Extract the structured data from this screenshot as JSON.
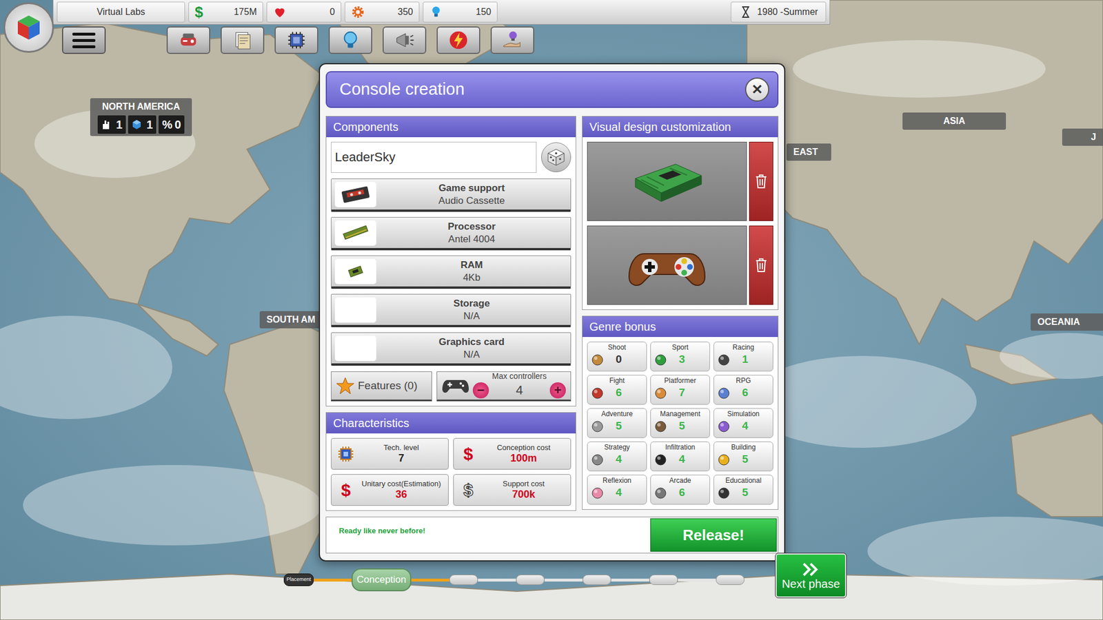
{
  "top_bar": {
    "company": "Virtual Labs",
    "stats": [
      {
        "kind": "money",
        "icon": "$",
        "value": "175M"
      },
      {
        "kind": "fans",
        "icon": "",
        "value": "0"
      },
      {
        "kind": "research",
        "icon": "",
        "value": "350"
      },
      {
        "kind": "ideas",
        "icon": "",
        "value": "150"
      }
    ],
    "date": "1980 -Summer"
  },
  "regions": [
    {
      "name": "NORTH AMERICA",
      "badges": [
        {
          "prefix": "",
          "value": "1"
        },
        {
          "prefix": "",
          "value": "1"
        },
        {
          "prefix": "%",
          "value": "0"
        }
      ]
    },
    {
      "name": "SOUTH AM",
      "badges": []
    },
    {
      "name": "EAST",
      "badges": []
    },
    {
      "name": "ASIA",
      "badges": []
    },
    {
      "name": "OCEANIA",
      "badges": []
    },
    {
      "name": "J",
      "badges": []
    }
  ],
  "dialog": {
    "title": "Console creation",
    "close": "✕",
    "components": {
      "header": "Components",
      "console_name": "LeaderSky",
      "items": [
        {
          "label": "Game support",
          "value": "Audio Cassette",
          "equipped": true
        },
        {
          "label": "Processor",
          "value": "Antel 4004",
          "equipped": true
        },
        {
          "label": "RAM",
          "value": "4Kb",
          "equipped": true
        },
        {
          "label": "Storage",
          "value": "N/A",
          "equipped": false
        },
        {
          "label": "Graphics card",
          "value": "N/A",
          "equipped": false
        }
      ],
      "features": "Features (0)",
      "max_controllers": {
        "label": "Max controllers",
        "value": "4",
        "minus": "−",
        "plus": "+"
      }
    },
    "characteristics": {
      "header": "Characteristics",
      "items": [
        {
          "label": "Tech. level",
          "value": "7",
          "icon": "",
          "color": "#222222"
        },
        {
          "label": "Conception cost",
          "value": "100m",
          "icon": "$",
          "color": "#d0021b"
        },
        {
          "label": "Unitary cost(Estimation)",
          "value": "36",
          "icon": "$",
          "color": "#d0021b"
        },
        {
          "label": "Support cost",
          "value": "700k",
          "icon": "$",
          "color": "#d0021b"
        }
      ]
    },
    "visual_design": {
      "header": "Visual design customization",
      "designs": [
        {
          "kind": "console"
        },
        {
          "kind": "controller"
        }
      ]
    },
    "genre_bonus": {
      "header": "Genre bonus",
      "genres": [
        {
          "name": "Shoot",
          "value": "0",
          "positive": false
        },
        {
          "name": "Sport",
          "value": "3",
          "positive": true
        },
        {
          "name": "Racing",
          "value": "1",
          "positive": true
        },
        {
          "name": "Fight",
          "value": "6",
          "positive": true
        },
        {
          "name": "Platformer",
          "value": "7",
          "positive": true
        },
        {
          "name": "RPG",
          "value": "6",
          "positive": true
        },
        {
          "name": "Adventure",
          "value": "5",
          "positive": true
        },
        {
          "name": "Management",
          "value": "5",
          "positive": true
        },
        {
          "name": "Simulation",
          "value": "4",
          "positive": true
        },
        {
          "name": "Strategy",
          "value": "4",
          "positive": true
        },
        {
          "name": "Infiltration",
          "value": "4",
          "positive": true
        },
        {
          "name": "Building",
          "value": "5",
          "positive": true
        },
        {
          "name": "Reflexion",
          "value": "4",
          "positive": true
        },
        {
          "name": "Arcade",
          "value": "6",
          "positive": true
        },
        {
          "name": "Educational",
          "value": "5",
          "positive": true
        }
      ]
    },
    "status": "Ready like never before!",
    "release": "Release!"
  },
  "phases": [
    {
      "label": "Placement",
      "done": true,
      "selected": false
    },
    {
      "label": "Conception",
      "done": false,
      "selected": true
    },
    {
      "label": "",
      "done": false,
      "selected": false
    },
    {
      "label": "",
      "done": false,
      "selected": false
    },
    {
      "label": "",
      "done": false,
      "selected": false
    },
    {
      "label": "",
      "done": false,
      "selected": false
    },
    {
      "label": "",
      "done": false,
      "selected": false
    }
  ],
  "next_phase": "Next phase"
}
